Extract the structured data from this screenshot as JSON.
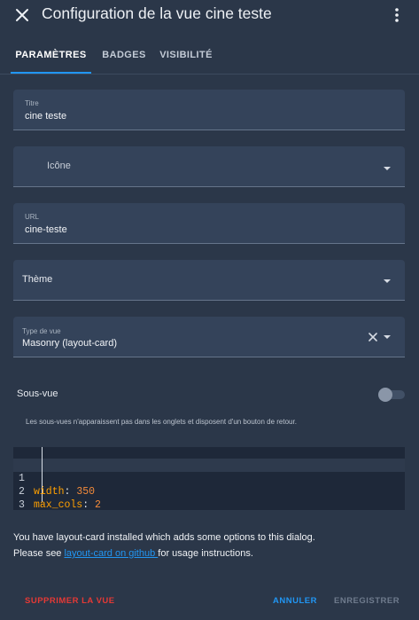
{
  "dialog": {
    "title": "Configuration de la vue cine teste"
  },
  "tabs": [
    {
      "label": "PARAMÈTRES",
      "active": true
    },
    {
      "label": "BADGES",
      "active": false
    },
    {
      "label": "VISIBILITÉ",
      "active": false
    }
  ],
  "fields": {
    "title": {
      "label": "Titre",
      "value": "cine teste"
    },
    "icon": {
      "placeholder": "Icône"
    },
    "url": {
      "label": "URL",
      "value": "cine-teste"
    },
    "theme": {
      "placeholder": "Thème"
    },
    "view_type": {
      "label": "Type de vue",
      "value": "Masonry (layout-card)"
    }
  },
  "subview": {
    "label": "Sous-vue",
    "enabled": false,
    "helper": "Les sous-vues n'apparaissent pas dans les onglets et disposent d'un bouton de retour."
  },
  "yaml_editor": {
    "lines": [
      {
        "number": "1",
        "key": "width",
        "value": "350"
      },
      {
        "number": "2",
        "key": "max_cols",
        "value": "2"
      },
      {
        "number": "3",
        "key": "",
        "value": ""
      }
    ]
  },
  "info": {
    "line1": "You have layout-card installed which adds some options to this dialog.",
    "line2_before": "Please see ",
    "line2_link": "layout-card on github ",
    "line2_after": "for usage instructions."
  },
  "footer": {
    "delete_label": "SUPPRIMER LA VUE",
    "cancel_label": "ANNULER",
    "save_label": "ENREGISTRER"
  },
  "colors": {
    "accent": "#2196f3",
    "danger": "#e53935",
    "background": "#2b3749",
    "field": "#34435a",
    "yaml_key": "#ffa000"
  },
  "icons": [
    "close-icon",
    "more-vert-icon",
    "dropdown-arrow-icon",
    "clear-icon"
  ]
}
